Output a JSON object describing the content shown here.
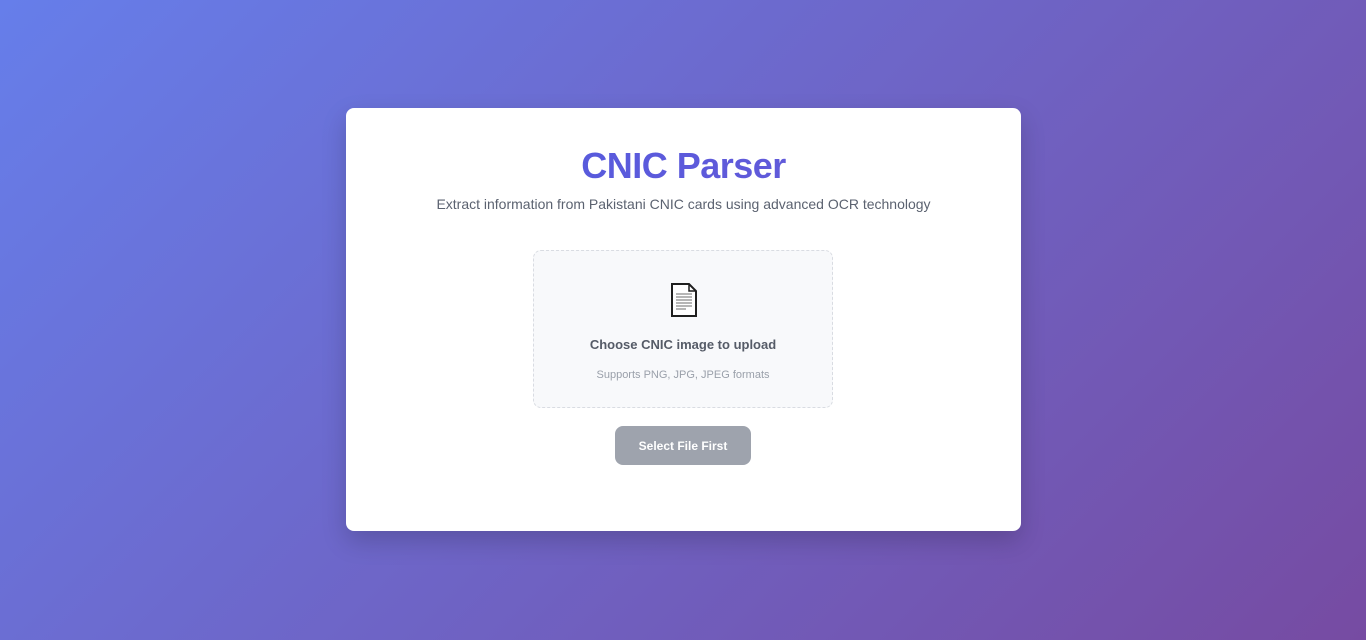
{
  "header": {
    "title": "CNIC Parser",
    "subtitle": "Extract information from Pakistani CNIC cards using advanced OCR technology"
  },
  "upload": {
    "icon": "document-icon",
    "label": "Choose CNIC image to upload",
    "hint": "Supports PNG, JPG, JPEG formats"
  },
  "submit": {
    "label": "Select File First",
    "state": "disabled"
  },
  "colors": {
    "background_start": "#667eea",
    "background_end": "#764ba2",
    "title_accent": "#5b5fe0",
    "button_disabled": "#9ea3ad"
  }
}
